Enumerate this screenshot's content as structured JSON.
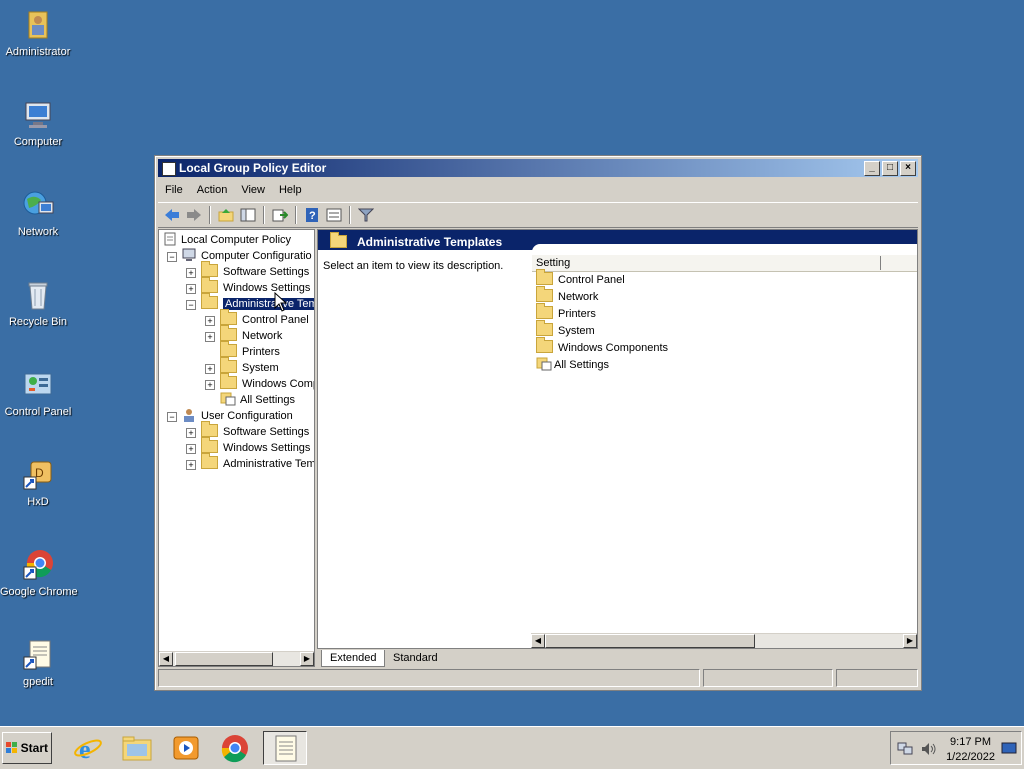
{
  "desktop": {
    "icons": [
      {
        "label": "Administrator",
        "icon": "user-folder-icon"
      },
      {
        "label": "Computer",
        "icon": "computer-icon"
      },
      {
        "label": "Network",
        "icon": "network-icon"
      },
      {
        "label": "Recycle Bin",
        "icon": "recycle-bin-icon"
      },
      {
        "label": "Control Panel",
        "icon": "control-panel-icon"
      },
      {
        "label": "HxD",
        "icon": "hxd-icon"
      },
      {
        "label": "Google Chrome",
        "icon": "chrome-icon"
      },
      {
        "label": "gpedit",
        "icon": "document-icon"
      }
    ]
  },
  "window": {
    "title": "Local Group Policy Editor",
    "controls": [
      "minimize",
      "maximize",
      "close"
    ],
    "menu": [
      "File",
      "Action",
      "View",
      "Help"
    ],
    "toolbar_icons": [
      "back-icon",
      "forward-icon",
      "up-folder-icon",
      "show-hide-tree-icon",
      "export-list-icon",
      "help-icon",
      "properties-icon",
      "filter-icon"
    ],
    "tree": {
      "root": "Local Computer Policy",
      "computer_config": "Computer Configuratio",
      "cc_software": "Software Settings",
      "cc_windows": "Windows Settings",
      "cc_admin": "Administrative Tem",
      "at_control_panel": "Control Panel",
      "at_network": "Network",
      "at_printers": "Printers",
      "at_system": "System",
      "at_windows_comp": "Windows Comp",
      "at_all_settings": "All Settings",
      "user_config": "User Configuration",
      "uc_software": "Software Settings",
      "uc_windows": "Windows Settings",
      "uc_admin": "Administrative Tem"
    },
    "right": {
      "header": "Administrative Templates",
      "description": "Select an item to view its description.",
      "column": "Setting",
      "items": [
        "Control Panel",
        "Network",
        "Printers",
        "System",
        "Windows Components",
        "All Settings"
      ]
    },
    "tabs": [
      "Extended",
      "Standard"
    ]
  },
  "taskbar": {
    "start": "Start",
    "apps": [
      "internet-explorer-icon",
      "explorer-icon",
      "media-player-icon",
      "chrome-icon",
      "gpedit-icon"
    ],
    "time": "9:17 PM",
    "date": "1/22/2022"
  }
}
